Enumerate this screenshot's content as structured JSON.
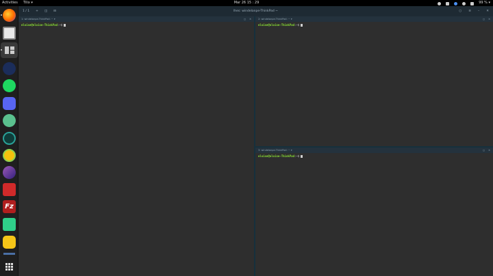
{
  "topbar": {
    "activities": "Activities",
    "app_menu": "Tilix ▾",
    "clock": "Mar 26  15 : 29",
    "battery": "99 % ▾",
    "tray_icons": [
      "cloud-icon",
      "wifi-icon",
      "tray-blue-icon",
      "volume-icon",
      "battery-icon",
      "power-icon"
    ]
  },
  "dock": {
    "apps": [
      "firefox",
      "files",
      "tilix",
      "steam",
      "spotify",
      "discord",
      "green-app",
      "teal-app",
      "yellow-app",
      "purple-app",
      "red-app",
      "filezilla",
      "bolt-app",
      "cat-app",
      "show-applications"
    ]
  },
  "window": {
    "session": "1 / 1",
    "title": "lhes: windelanpe-ThinkPad ~",
    "controls": [
      "search",
      "menu",
      "minimize",
      "close"
    ]
  },
  "panes": [
    {
      "title": "1: windelanpe-ThinkPad: ~ ▾",
      "prompt_user": "eloise@eloise-ThinkPad",
      "prompt_suffix": ":~$"
    },
    {
      "title": "2: windelanpe-ThinkPad: ~ ▾",
      "prompt_user": "eloise@eloise-ThinkPad",
      "prompt_suffix": ":~$"
    },
    {
      "title": "3: windelanpe-ThinkPad: ~ ▾",
      "prompt_user": "eloise@eloise-ThinkPad",
      "prompt_suffix": ":~$"
    }
  ],
  "colors": {
    "prompt_user": "#8ae234",
    "terminal_bg": "#2e2e2e",
    "header_bg": "#1e2a33",
    "divider": "#16303d"
  }
}
